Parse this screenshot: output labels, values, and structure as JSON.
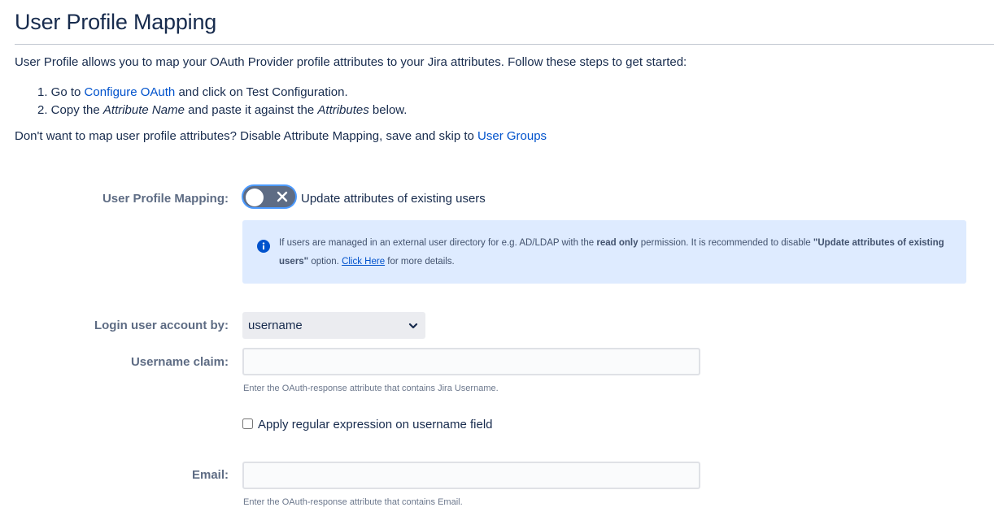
{
  "header": {
    "title": "User Profile Mapping"
  },
  "intro": {
    "text": "User Profile allows you to map your OAuth Provider profile attributes to your Jira attributes. Follow these steps to get started:"
  },
  "steps": {
    "step1_prefix": "1. Go to ",
    "step1_link": "Configure OAuth",
    "step1_suffix": " and click on Test Configuration.",
    "step2_prefix": "2. Copy the ",
    "step2_em1": "Attribute Name",
    "step2_middle": " and paste it against the ",
    "step2_em2": "Attributes",
    "step2_suffix": " below."
  },
  "skip": {
    "text": "Don't want to map user profile attributes? Disable Attribute Mapping, save and skip to ",
    "link": "User Groups"
  },
  "profile_mapping": {
    "label": "User Profile Mapping:",
    "toggle_state": "off",
    "toggle_text": "Update attributes of existing users"
  },
  "info": {
    "part1": "If users are managed in an external user directory for e.g. AD/LDAP with the ",
    "bold1": "read only",
    "part2": " permission. It is recommended to disable ",
    "bold2": "\"Update attributes of existing users\"",
    "part3": " option. ",
    "link": "Click Here",
    "part4": " for more details.",
    "color": "#deebff"
  },
  "login_by": {
    "label": "Login user account by:",
    "selected": "username"
  },
  "username_claim": {
    "label": "Username claim:",
    "value": "",
    "help": "Enter the OAuth-response attribute that contains Jira Username."
  },
  "regex": {
    "checked": false,
    "label": "Apply regular expression on username field"
  },
  "email": {
    "label": "Email:",
    "value": "",
    "help": "Enter the OAuth-response attribute that contains Email."
  },
  "colors": {
    "link": "#0052cc",
    "toggle_off": "#5e6c84",
    "focus_ring": "#4c9aff"
  }
}
